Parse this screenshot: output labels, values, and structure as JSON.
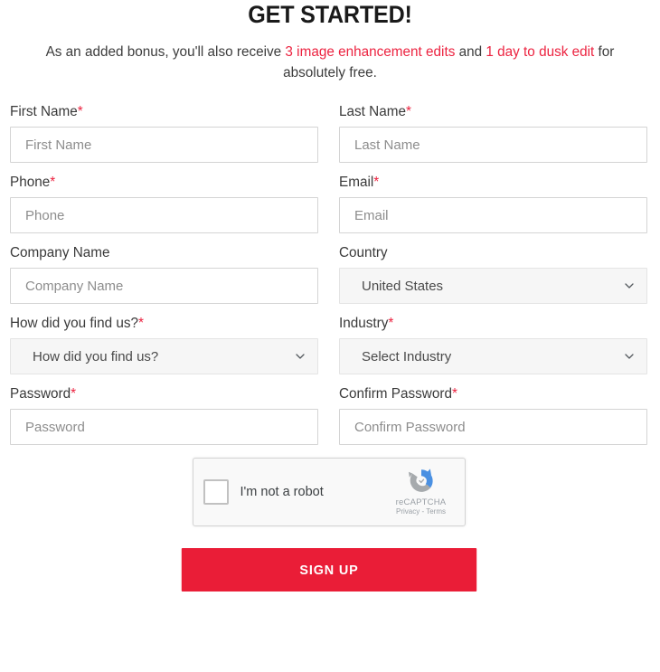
{
  "header": {
    "title": "GET STARTED!",
    "subtitle_parts": [
      {
        "text": "As an added bonus, you'll also receive ",
        "highlight": false
      },
      {
        "text": "3 image enhancement edits",
        "highlight": true
      },
      {
        "text": " and ",
        "highlight": false
      },
      {
        "text": "1 day to dusk edit",
        "highlight": true
      },
      {
        "text": " for absolutely free.",
        "highlight": false
      }
    ],
    "subtitle_plain": "As an added bonus, you'll also receive 3 image enhancement edits and 1 day to dusk edit for absolutely free."
  },
  "colors": {
    "accent_red": "#ec2340",
    "button_red": "#ea1d37",
    "label_text": "#3a3a3a",
    "placeholder": "#8d8d8d",
    "input_border": "#d4d4d4",
    "select_bg": "#f6f6f6",
    "captcha_bg": "#f9f9f9",
    "recaptcha_blue": "#4a90e2",
    "recaptcha_gray": "#9aa0a6"
  },
  "form": {
    "rows": [
      {
        "left": {
          "label": "First Name",
          "required": true,
          "type": "text",
          "placeholder": "First Name",
          "value": "",
          "name": "first-name"
        },
        "right": {
          "label": "Last Name",
          "required": true,
          "type": "text",
          "placeholder": "Last Name",
          "value": "",
          "name": "last-name"
        }
      },
      {
        "left": {
          "label": "Phone",
          "required": true,
          "type": "text",
          "placeholder": "Phone",
          "value": "",
          "name": "phone"
        },
        "right": {
          "label": "Email",
          "required": true,
          "type": "text",
          "placeholder": "Email",
          "value": "",
          "name": "email"
        }
      },
      {
        "left": {
          "label": "Company Name",
          "required": false,
          "type": "text",
          "placeholder": "Company Name",
          "value": "",
          "name": "company-name"
        },
        "right": {
          "label": "Country",
          "required": false,
          "type": "select",
          "selected": "United States",
          "name": "country"
        }
      },
      {
        "left": {
          "label": "How did you find us?",
          "required": true,
          "type": "select",
          "selected": "How did you find us?",
          "name": "how-did-you-find-us"
        },
        "right": {
          "label": "Industry",
          "required": true,
          "type": "select",
          "selected": "Select Industry",
          "name": "industry"
        }
      },
      {
        "left": {
          "label": "Password",
          "required": true,
          "type": "text",
          "placeholder": "Password",
          "value": "",
          "name": "password"
        },
        "right": {
          "label": "Confirm Password",
          "required": true,
          "type": "text",
          "placeholder": "Confirm Password",
          "value": "",
          "name": "confirm-password"
        }
      }
    ],
    "labels": {
      "first_name": "First Name",
      "last_name": "Last Name",
      "phone": "Phone",
      "email": "Email",
      "company_name": "Company Name",
      "country": "Country",
      "how_did_you_find_us": "How did you find us?",
      "industry": "Industry",
      "password": "Password",
      "confirm_password": "Confirm Password"
    },
    "placeholders": {
      "first_name": "First Name",
      "last_name": "Last Name",
      "phone": "Phone",
      "email": "Email",
      "company_name": "Company Name",
      "password": "Password",
      "confirm_password": "Confirm Password"
    },
    "selects": {
      "country_selected": "United States",
      "how_did_you_find_us_selected": "How did you find us?",
      "industry_selected": "Select Industry"
    },
    "required_marker": "*"
  },
  "captcha": {
    "label": "I'm not a robot",
    "brand": "reCAPTCHA",
    "legal": "Privacy - Terms",
    "checked": false
  },
  "submit": {
    "label": "SIGN UP"
  }
}
